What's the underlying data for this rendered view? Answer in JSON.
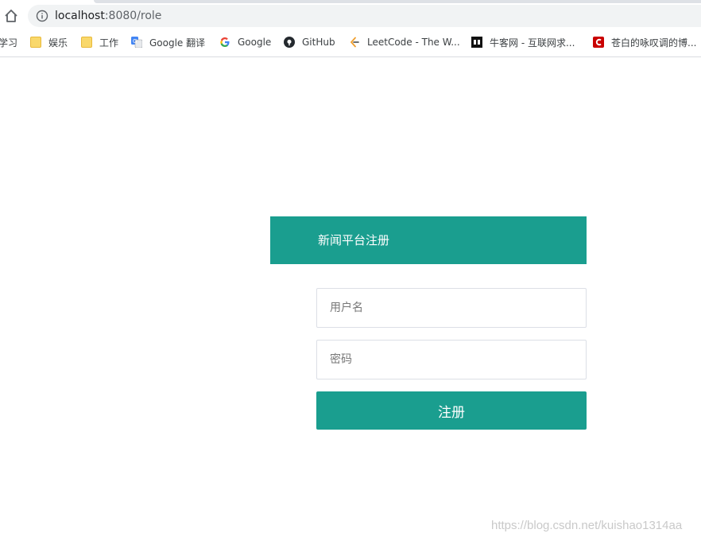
{
  "browser": {
    "url_host": "localhost",
    "url_rest": ":8080/role",
    "bookmarks": [
      {
        "label": "学习",
        "icon": "folder-icon"
      },
      {
        "label": "娱乐",
        "icon": "folder-icon"
      },
      {
        "label": "工作",
        "icon": "folder-icon"
      },
      {
        "label": "Google 翻译",
        "icon": "google-translate-icon"
      },
      {
        "label": "Google",
        "icon": "google-icon"
      },
      {
        "label": "GitHub",
        "icon": "github-icon"
      },
      {
        "label": "LeetCode - The W...",
        "icon": "leetcode-icon"
      },
      {
        "label": "牛客网 - 互联网求...",
        "icon": "nowcoder-icon"
      },
      {
        "label": "苍白的咏叹调的博...",
        "icon": "csdn-icon"
      }
    ]
  },
  "register": {
    "title": "新闻平台注册",
    "username_placeholder": "用户名",
    "password_placeholder": "密码",
    "submit_label": "注册"
  },
  "watermark": "https://blog.csdn.net/kuishao1314aa",
  "colors": {
    "accent": "#1a9e8f"
  }
}
